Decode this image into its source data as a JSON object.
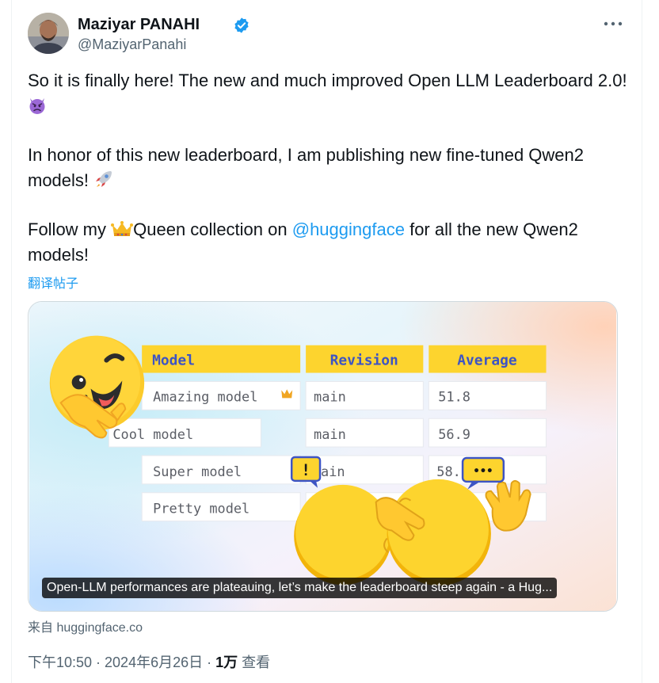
{
  "author": {
    "name": "Maziyar PANAHI",
    "handle": "@MaziyarPanahi",
    "verified_color": "#1d9bf0"
  },
  "tweet": {
    "line1": "So it is finally here! The new and much improved Open LLM Leaderboard 2.0!",
    "emoji1": "devil-face-icon",
    "line2": "In honor of this new leaderboard, I am publishing new fine-tuned Qwen2 models!",
    "emoji2": "rocket-icon",
    "line3_before": "Follow my",
    "emoji3": "crown-icon",
    "line3_middle": "Queen collection on",
    "mention": "@huggingface",
    "line3_after": "for all the new Qwen2 models!"
  },
  "translate_label": "翻译帖子",
  "card": {
    "table_headers": [
      "Model",
      "Revision",
      "Average"
    ],
    "rows": [
      {
        "model": "Amazing model",
        "revision": "main",
        "average": "51.8"
      },
      {
        "model": "Cool model",
        "revision": "main",
        "average": "56.9"
      },
      {
        "model": "Super model",
        "revision": "ain",
        "average": "58."
      },
      {
        "model": "Pretty model",
        "revision": "",
        "average": ""
      }
    ],
    "exclaim": "!",
    "dots": "•••",
    "caption": "Open-LLM performances are plateauing, let’s make the leaderboard steep again - a Hug..."
  },
  "source_label": "来自 huggingface.co",
  "meta": {
    "time": "下午10:50 · 2024年6月26日 ·",
    "views_count": "1万",
    "views_label": "查看"
  },
  "colors": {
    "accent": "#1d9bf0",
    "header_yellow": "#fdd42e",
    "header_text": "#3d54c4"
  }
}
